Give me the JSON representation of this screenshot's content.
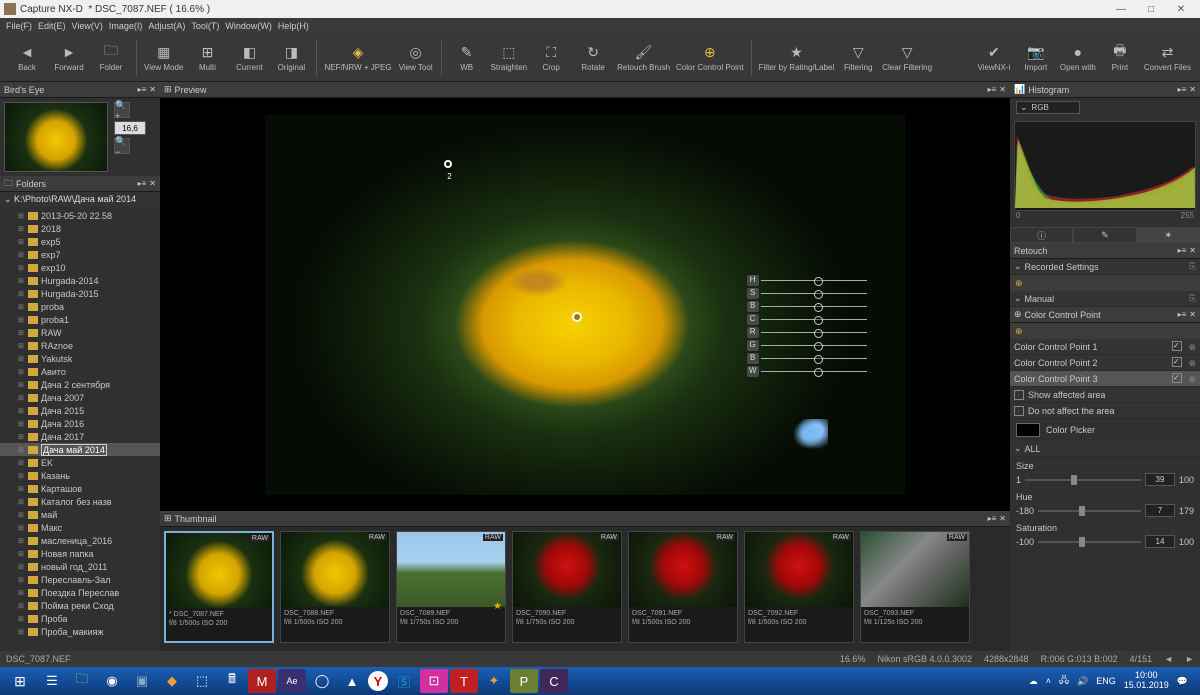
{
  "app": {
    "name": "Capture NX-D",
    "filename": "* DSC_7087.NEF",
    "zoom_title": "( 16.6% )"
  },
  "winctl": {
    "min": "—",
    "max": "□",
    "close": "✕"
  },
  "menu": [
    "File(F)",
    "Edit(E)",
    "View(V)",
    "Image(I)",
    "Adjust(A)",
    "Tool(T)",
    "Window(W)",
    "Help(H)"
  ],
  "toolbar": [
    {
      "id": "back",
      "label": "Back",
      "glyph": "◄"
    },
    {
      "id": "forward",
      "label": "Forward",
      "glyph": "►"
    },
    {
      "id": "folder",
      "label": "Folder",
      "glyph": "🗀"
    },
    {
      "sep": true
    },
    {
      "id": "viewmode",
      "label": "View Mode",
      "glyph": "▦"
    },
    {
      "id": "multi",
      "label": "Multi",
      "glyph": "⊞"
    },
    {
      "id": "current",
      "label": "Current",
      "glyph": "◧"
    },
    {
      "id": "original",
      "label": "Original",
      "glyph": "◨"
    },
    {
      "sep": true
    },
    {
      "id": "nefjpeg",
      "label": "NEF/NRW + JPEG",
      "glyph": "◈",
      "active": true
    },
    {
      "id": "viewtool",
      "label": "View Tool",
      "glyph": "◎"
    },
    {
      "sep": true
    },
    {
      "id": "wb",
      "label": "WB",
      "glyph": "✎"
    },
    {
      "id": "straighten",
      "label": "Straighten",
      "glyph": "⬚"
    },
    {
      "id": "crop",
      "label": "Crop",
      "glyph": "⛶"
    },
    {
      "id": "rotate",
      "label": "Rotate",
      "glyph": "↻"
    },
    {
      "id": "retouch",
      "label": "Retouch Brush",
      "glyph": "🖌"
    },
    {
      "id": "ccp",
      "label": "Color Control Point",
      "glyph": "⊕",
      "active": true
    },
    {
      "sep": true
    },
    {
      "id": "filterrating",
      "label": "Filter by Rating/Label",
      "glyph": "★"
    },
    {
      "id": "filtering",
      "label": "Filtering",
      "glyph": "▽"
    },
    {
      "id": "clearfilter",
      "label": "Clear Filtering",
      "glyph": "▽"
    },
    {
      "spacer": true
    },
    {
      "id": "viewnx",
      "label": "ViewNX-i",
      "glyph": "✔"
    },
    {
      "id": "import",
      "label": "Import",
      "glyph": "📷"
    },
    {
      "id": "openwith",
      "label": "Open with",
      "glyph": "●"
    },
    {
      "id": "print",
      "label": "Print",
      "glyph": "🖶"
    },
    {
      "id": "convert",
      "label": "Convert Files",
      "glyph": "⇄"
    }
  ],
  "birdseye": {
    "title": "Bird's Eye",
    "zoom": "16,6"
  },
  "folders": {
    "title": "Folders",
    "path": "K:\\Photo\\RAW\\Дача май 2014",
    "items": [
      {
        "n": "2013-05-20 22.58"
      },
      {
        "n": "2018"
      },
      {
        "n": "exp5"
      },
      {
        "n": "exp7"
      },
      {
        "n": "exp10"
      },
      {
        "n": "Hurgada-2014"
      },
      {
        "n": "Hurgada-2015"
      },
      {
        "n": "proba"
      },
      {
        "n": "proba1"
      },
      {
        "n": "RAW"
      },
      {
        "n": "RAznoe"
      },
      {
        "n": "Yakutsk"
      },
      {
        "n": "Авито"
      },
      {
        "n": "Дача 2 сентября"
      },
      {
        "n": "Дача 2007"
      },
      {
        "n": "Дача 2015"
      },
      {
        "n": "Дача 2016"
      },
      {
        "n": "Дача 2017"
      },
      {
        "n": "Дача май 2014",
        "sel": true
      },
      {
        "n": "EK"
      },
      {
        "n": "Казань"
      },
      {
        "n": "Карташов"
      },
      {
        "n": "Каталог без назв"
      },
      {
        "n": "май"
      },
      {
        "n": "Макс"
      },
      {
        "n": "масленица_2016"
      },
      {
        "n": "Новая папка"
      },
      {
        "n": "новый год_2011"
      },
      {
        "n": "Переславль-Зал"
      },
      {
        "n": "Поездка Переслав"
      },
      {
        "n": "Пойма реки Сход"
      },
      {
        "n": "Проба"
      },
      {
        "n": "Проба_макияж"
      }
    ]
  },
  "preview": {
    "title": "Preview",
    "sliders": [
      "H",
      "S",
      "B",
      "C",
      "R",
      "G",
      "B",
      "W"
    ]
  },
  "thumbnail": {
    "title": "Thumbnail",
    "items": [
      {
        "name": "* DSC_7087.NEF",
        "info": "f/8 1/500s ISO 200",
        "cls": "dand",
        "sel": true,
        "star": false
      },
      {
        "name": "DSC_7088.NEF",
        "info": "f/8 1/500s ISO 200",
        "cls": "dand",
        "star": false
      },
      {
        "name": "DSC_7089.NEF",
        "info": "f/8 1/750s ISO 200",
        "cls": "tree",
        "star": true
      },
      {
        "name": "DSC_7090.NEF",
        "info": "f/8 1/750s ISO 200",
        "cls": "red"
      },
      {
        "name": "DSC_7091.NEF",
        "info": "f/8 1/500s ISO 200",
        "cls": "red"
      },
      {
        "name": "DSC_7092.NEF",
        "info": "f/8 1/500s ISO 200",
        "cls": "red"
      },
      {
        "name": "DSC_7093.NEF",
        "info": "f/8 1/125s ISO 200",
        "cls": "cat"
      }
    ]
  },
  "histogram": {
    "title": "Histogram",
    "channel": "RGB",
    "min": "0",
    "max": "255"
  },
  "retouch": {
    "title": "Retouch",
    "recorded": "Recorded Settings",
    "manual": "Manual"
  },
  "ccp_panel": {
    "title": "Color Control Point",
    "points": [
      "Color Control Point 1",
      "Color Control Point 2",
      "Color Control Point 3"
    ],
    "show_affected": "Show affected area",
    "not_affect": "Do not affect the area",
    "color_picker": "Color Picker",
    "all": "ALL",
    "size": {
      "label": "Size",
      "min": "1",
      "val": "39",
      "max": "100"
    },
    "hue": {
      "label": "Hue",
      "min": "-180",
      "val": "7",
      "max": "179"
    },
    "sat": {
      "label": "Saturation",
      "min": "-100",
      "val": "14",
      "max": "100"
    }
  },
  "status": {
    "file": "DSC_7087.NEF",
    "zoom": "16.6%",
    "profile": "Nikon sRGB 4.0.0.3002",
    "dim": "4288x2848",
    "rgb": "R:006 G:013 B:002",
    "pos": "4/151"
  },
  "taskbar": {
    "time": "10:00",
    "date": "15.01.2019",
    "lang": "ENG"
  }
}
